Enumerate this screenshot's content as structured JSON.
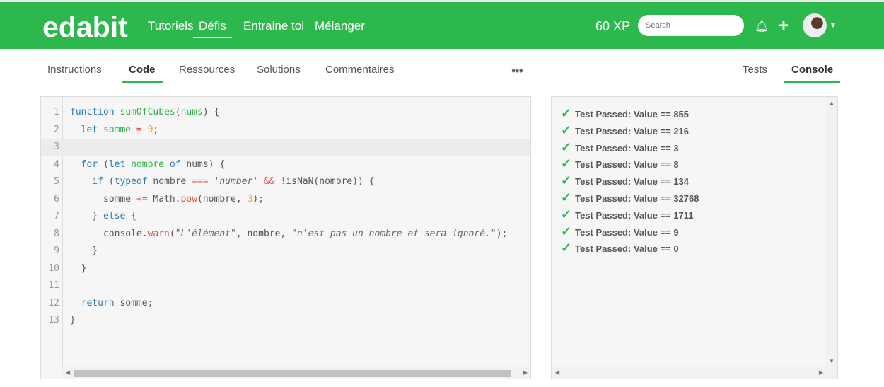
{
  "nav": {
    "logo": "edabit",
    "links": [
      "Tutoriels",
      "Défis",
      "Entraine toi",
      "Mélanger"
    ],
    "active": "Défis",
    "xp": "60 XP",
    "search_placeholder": "Search"
  },
  "tabs": {
    "left": [
      "Instructions",
      "Code",
      "Ressources",
      "Solutions",
      "Commentaires"
    ],
    "more": "•••",
    "right": [
      "Tests",
      "Console"
    ],
    "active_left": "Code",
    "active_right": "Console"
  },
  "code": [
    [
      [
        "kw",
        "function "
      ],
      [
        "def",
        "sumOfCubes"
      ],
      [
        "pl",
        "("
      ],
      [
        "def",
        "nums"
      ],
      [
        "pl",
        ") {"
      ]
    ],
    [
      [
        "kw",
        "  let "
      ],
      [
        "def",
        "somme"
      ],
      [
        "op",
        " = "
      ],
      [
        "num",
        "0"
      ],
      [
        "pl",
        ";"
      ]
    ],
    [],
    [
      [
        "kw",
        "  for "
      ],
      [
        "pl",
        "("
      ],
      [
        "kw",
        "let "
      ],
      [
        "def",
        "nombre"
      ],
      [
        "kw",
        " of "
      ],
      [
        "pl",
        "nums) {"
      ]
    ],
    [
      [
        "kw",
        "    if "
      ],
      [
        "pl",
        "("
      ],
      [
        "kw",
        "typeof "
      ],
      [
        "pl",
        "nombre "
      ],
      [
        "op",
        "==="
      ],
      [
        "pl",
        " "
      ],
      [
        "str",
        "'number'"
      ],
      [
        "pl",
        " "
      ],
      [
        "op",
        "&&"
      ],
      [
        "pl",
        " "
      ],
      [
        "op",
        "!"
      ],
      [
        "pl",
        "isNaN(nombre)) {"
      ]
    ],
    [
      [
        "pl",
        "      somme "
      ],
      [
        "op",
        "+="
      ],
      [
        "pl",
        " Math."
      ],
      [
        "fn",
        "pow"
      ],
      [
        "pl",
        "(nombre, "
      ],
      [
        "num",
        "3"
      ],
      [
        "pl",
        ");"
      ]
    ],
    [
      [
        "pl",
        "    } "
      ],
      [
        "kw",
        "else"
      ],
      [
        "pl",
        " {"
      ]
    ],
    [
      [
        "pl",
        "      console."
      ],
      [
        "fn",
        "warn"
      ],
      [
        "pl",
        "("
      ],
      [
        "str",
        "\"L'élément\""
      ],
      [
        "pl",
        ", nombre, "
      ],
      [
        "str",
        "\"n'est pas un nombre et sera ignoré.\""
      ],
      [
        "pl",
        ");"
      ]
    ],
    [
      [
        "pl",
        "    }"
      ]
    ],
    [
      [
        "pl",
        "  }"
      ]
    ],
    [],
    [
      [
        "kw",
        "  return "
      ],
      [
        "pl",
        "somme;"
      ]
    ],
    [
      [
        "pl",
        "}"
      ]
    ]
  ],
  "console": {
    "results": [
      "Test Passed: Value == 855",
      "Test Passed: Value == 216",
      "Test Passed: Value == 3",
      "Test Passed: Value == 8",
      "Test Passed: Value == 134",
      "Test Passed: Value == 32768",
      "Test Passed: Value == 1711",
      "Test Passed: Value == 9",
      "Test Passed: Value == 0"
    ],
    "check_icon": "✓"
  },
  "colors": {
    "brand": "#2db84d"
  }
}
